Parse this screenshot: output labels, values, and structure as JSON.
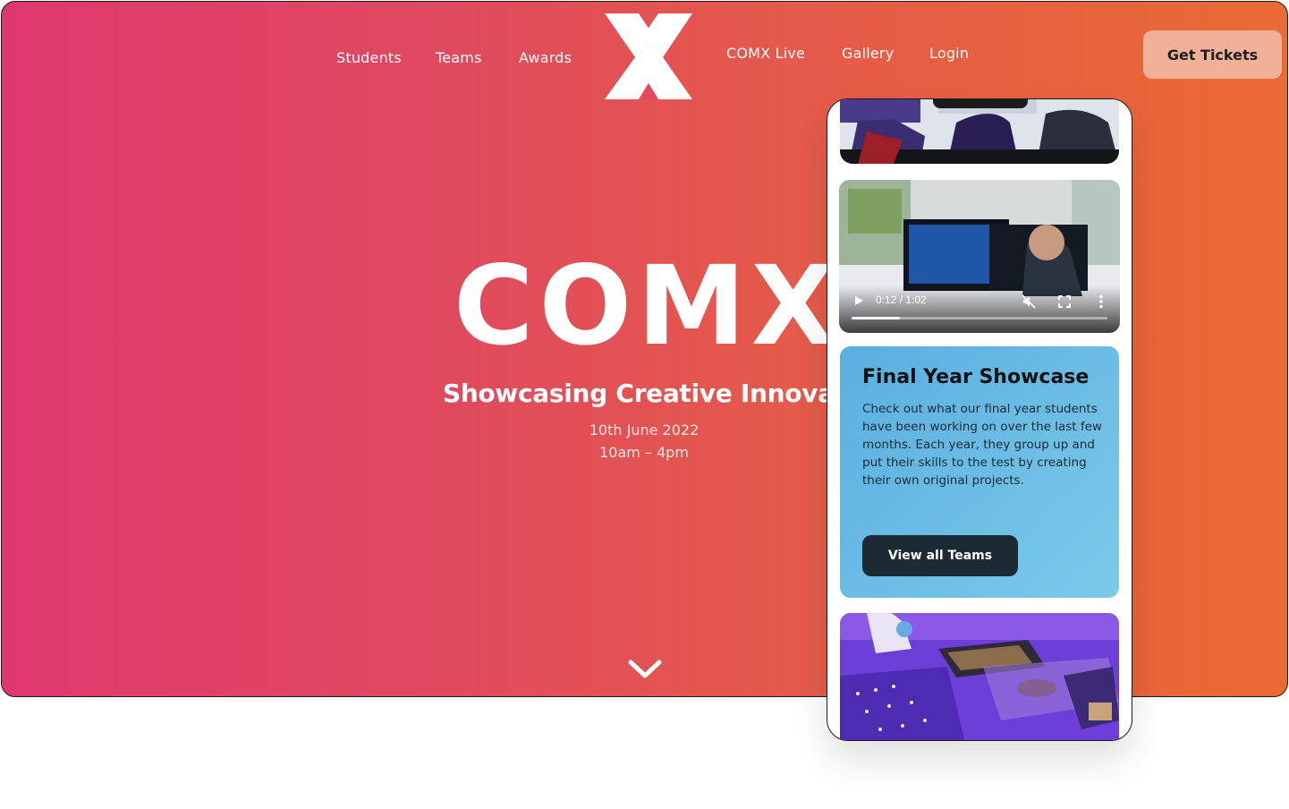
{
  "nav": {
    "left_items": [
      {
        "label": "Students"
      },
      {
        "label": "Teams"
      },
      {
        "label": "Awards"
      }
    ],
    "right_items": [
      {
        "label": "COMX Live"
      },
      {
        "label": "Gallery"
      },
      {
        "label": "Login"
      }
    ],
    "cta_label": "Get Tickets",
    "logo_icon": "comx-x-logo-icon"
  },
  "hero": {
    "wordmark": "COMX",
    "subtitle": "Showcasing Creative Innovation",
    "date": "10th June 2022",
    "time": "10am – 4pm",
    "scroll_icon": "chevron-down-icon"
  },
  "colors": {
    "gradient_start": "#df3870",
    "gradient_end": "#ea6a33",
    "cta_background": "#f1b09a",
    "card_background": "#6bbde6",
    "button_dark": "#1b2a33"
  },
  "mobile": {
    "video": {
      "current_time": "0:12",
      "duration": "1:02",
      "time_display": "0:12 / 1:02",
      "progress": 0.19,
      "play_icon": "play-icon",
      "mute_icon": "muted-speaker-icon",
      "fullscreen_icon": "fullscreen-icon",
      "menu_icon": "more-vertical-icon"
    },
    "card": {
      "title": "Final Year Showcase",
      "body": "Check out what our final year students have been working on over the last few months. Each year, they group up and put their skills to the test by creating their own original projects.",
      "button_label": "View all Teams"
    }
  }
}
